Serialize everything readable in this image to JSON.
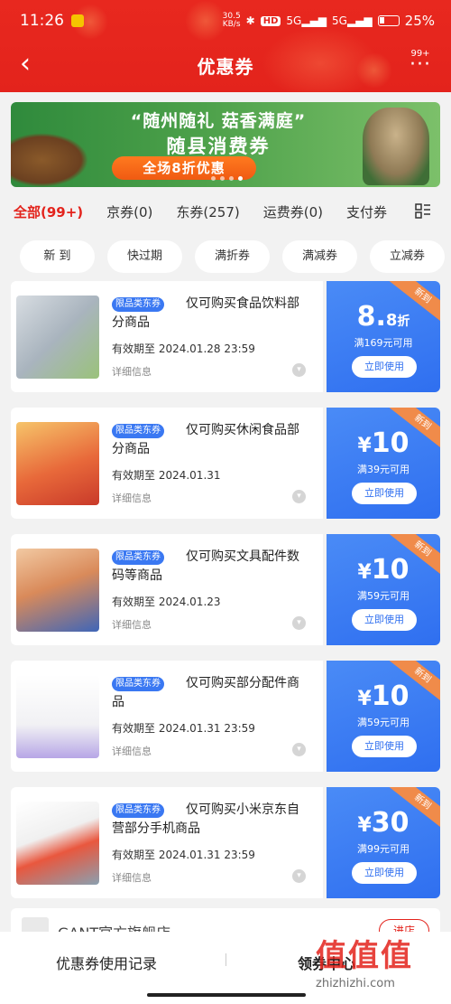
{
  "status_bar": {
    "time": "11:26",
    "net_speed_value": "30.5",
    "net_speed_unit": "KB/s",
    "hd_label": "HD",
    "signal_1": "5G",
    "signal_2": "5G",
    "battery": "25%"
  },
  "nav": {
    "title": "优惠券",
    "more_badge": "99+"
  },
  "banner": {
    "line1": "“随州随礼 菇香满庭”",
    "line2": "随县消费券",
    "pill": "全场8折优惠"
  },
  "tabs": [
    {
      "label": "全部(99+)",
      "active": true
    },
    {
      "label": "京券(0)",
      "active": false
    },
    {
      "label": "东券(257)",
      "active": false
    },
    {
      "label": "运费券(0)",
      "active": false
    },
    {
      "label": "支付券",
      "active": false
    }
  ],
  "chips": [
    "新 到",
    "快过期",
    "满折券",
    "满减券",
    "立减券"
  ],
  "coupons": [
    {
      "tag": "限品类东券",
      "desc": "仅可购买食品饮料部分商品",
      "expiry": "有效期至 2024.01.28 23:59",
      "detail": "详细信息",
      "ribbon": "新到",
      "amount_symbol": "",
      "amount_value": "8.",
      "amount_value_small": "8",
      "amount_unit": "折",
      "condition": "满169元可用",
      "button": "立即使用"
    },
    {
      "tag": "限品类东券",
      "desc": "仅可购买休闲食品部分商品",
      "expiry": "有效期至 2024.01.31",
      "detail": "详细信息",
      "ribbon": "新到",
      "amount_symbol": "¥",
      "amount_value": "10",
      "amount_value_small": "",
      "amount_unit": "",
      "condition": "满39元可用",
      "button": "立即使用"
    },
    {
      "tag": "限品类东券",
      "desc": "仅可购买文具配件数码等商品",
      "expiry": "有效期至 2024.01.23",
      "detail": "详细信息",
      "ribbon": "新到",
      "amount_symbol": "¥",
      "amount_value": "10",
      "amount_value_small": "",
      "amount_unit": "",
      "condition": "满59元可用",
      "button": "立即使用"
    },
    {
      "tag": "限品类东券",
      "desc": "仅可购买部分配件商品",
      "expiry": "有效期至 2024.01.31 23:59",
      "detail": "详细信息",
      "ribbon": "新到",
      "amount_symbol": "¥",
      "amount_value": "10",
      "amount_value_small": "",
      "amount_unit": "",
      "condition": "满59元可用",
      "button": "立即使用"
    },
    {
      "tag": "限品类东券",
      "desc": "仅可购买小米京东自营部分手机商品",
      "expiry": "有效期至 2024.01.31 23:59",
      "detail": "详细信息",
      "ribbon": "新到",
      "amount_symbol": "¥",
      "amount_value": "30",
      "amount_value_small": "",
      "amount_unit": "",
      "condition": "满99元可用",
      "button": "立即使用"
    }
  ],
  "thumb_colors": [
    "#cfd6dc",
    "#f3b35a",
    "#e6a26a",
    "#f4f4f6",
    "#f2f2f2"
  ],
  "store": {
    "name": "GANT官方旗舰店",
    "enter": "进店"
  },
  "bottom_bar": {
    "history": "优惠券使用记录",
    "get_more": "领券中心"
  },
  "watermark": {
    "logo": "值值值",
    "url": "zhizhizhi.com"
  },
  "colors": {
    "brand_red": "#e3231c",
    "coupon_blue": "#2f6ff0",
    "tag_blue": "#3a78f2",
    "ribbon_orange": "#f08b4a"
  }
}
